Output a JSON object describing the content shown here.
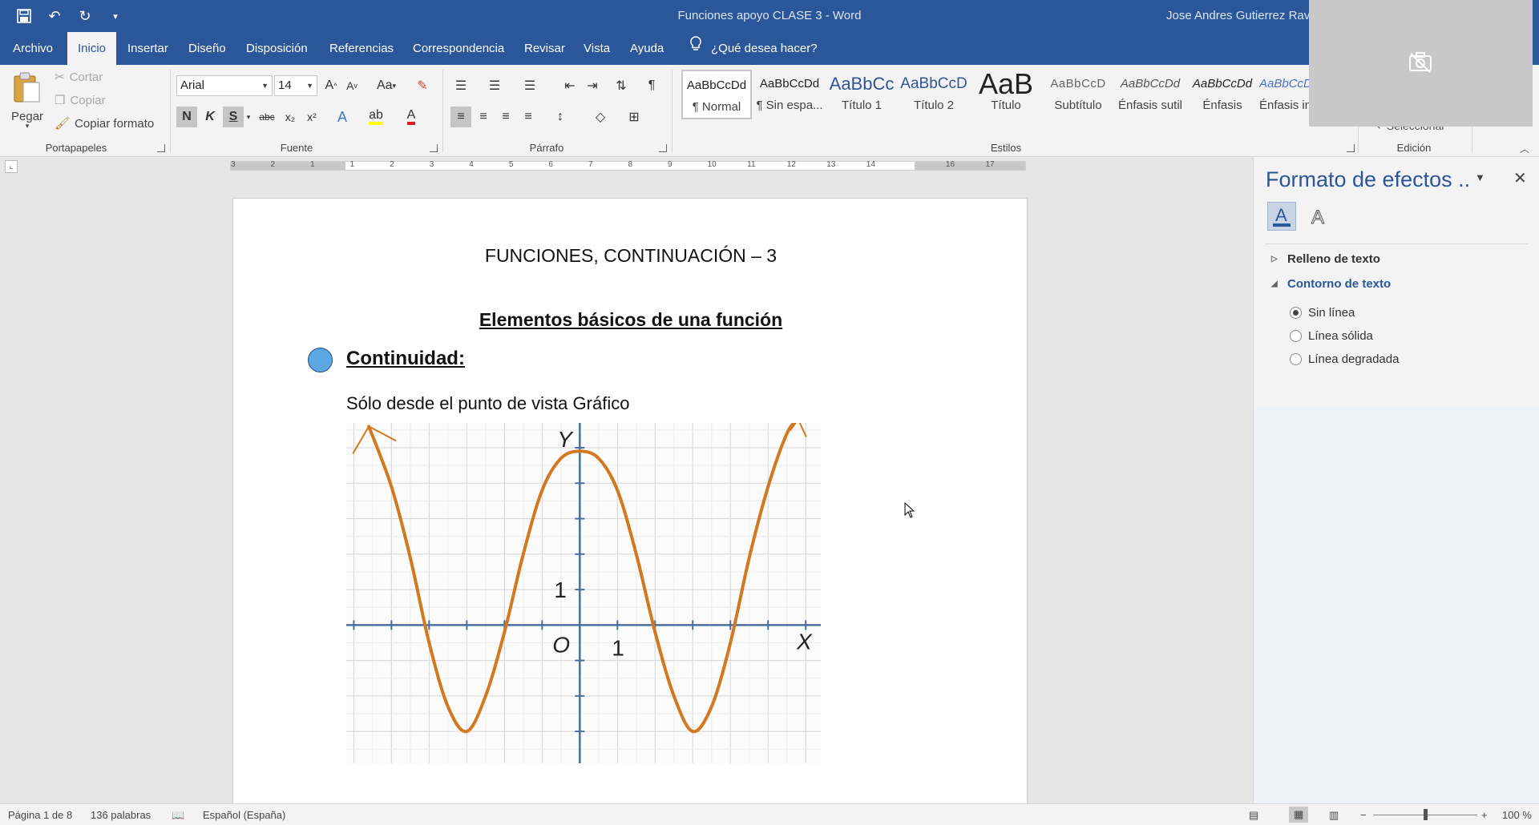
{
  "titlebar": {
    "document_title": "Funciones apoyo CLASE 3  -  Word",
    "user_name": "Jose Andres Gutierrez Rave"
  },
  "menu": {
    "tabs": [
      "Archivo",
      "Inicio",
      "Insertar",
      "Diseño",
      "Disposición",
      "Referencias",
      "Correspondencia",
      "Revisar",
      "Vista",
      "Ayuda"
    ],
    "active_tab": "Inicio",
    "tell_me": "¿Qué desea hacer?"
  },
  "ribbon": {
    "clipboard": {
      "paste": "Pegar",
      "cut": "Cortar",
      "copy": "Copiar",
      "format_painter": "Copiar formato",
      "group_label": "Portapapeles"
    },
    "font": {
      "font_name": "Arial",
      "font_size": "14",
      "group_label": "Fuente",
      "bold": "N",
      "italic": "K",
      "underline": "S",
      "strike": "abc",
      "subscript": "x₂",
      "superscript": "x²",
      "case": "Aa"
    },
    "paragraph": {
      "group_label": "Párrafo"
    },
    "styles": {
      "group_label": "Estilos",
      "items": [
        {
          "preview": "AaBbCcDd",
          "name": "¶ Normal"
        },
        {
          "preview": "AaBbCcDd",
          "name": "¶ Sin espa..."
        },
        {
          "preview": "AaBbCc",
          "name": "Título 1"
        },
        {
          "preview": "AaBbCcD",
          "name": "Título 2"
        },
        {
          "preview": "AaB",
          "name": "Título"
        },
        {
          "preview": "AaBbCcD",
          "name": "Subtítulo"
        },
        {
          "preview": "AaBbCcDd",
          "name": "Énfasis sutil"
        },
        {
          "preview": "AaBbCcDd",
          "name": "Énfasis"
        },
        {
          "preview": "AaBbCcDd",
          "name": "Énfasis in"
        }
      ]
    },
    "editing": {
      "select": "Seleccionar",
      "group_label": "Edición"
    }
  },
  "ruler": {
    "numbers": [
      "3",
      "2",
      "1",
      "1",
      "2",
      "3",
      "4",
      "5",
      "6",
      "7",
      "8",
      "9",
      "10",
      "11",
      "12",
      "13",
      "14",
      "16",
      "17"
    ]
  },
  "document": {
    "title": "FUNCIONES, CONTINUACIÓN – 3",
    "subtitle": "Elementos básicos de una función",
    "section_heading": "Continuidad:",
    "paragraph": "Sólo desde el punto de vista Gráfico",
    "graph": {
      "y_label": "Y",
      "x_label": "X",
      "origin_label": "O",
      "x_tick_label": "1",
      "y_tick_label": "1"
    }
  },
  "chart_data": {
    "type": "line",
    "title": "",
    "xlabel": "X",
    "ylabel": "Y",
    "xlim": [
      -6.2,
      6.4
    ],
    "ylim": [
      -3.9,
      5.7
    ],
    "grid": true,
    "x_tick_labels": [
      "1"
    ],
    "y_tick_labels": [
      "1"
    ],
    "series": [
      {
        "x": [
          -5.6,
          -5.0,
          -4.5,
          -4.0,
          -3.5,
          -3.0,
          -2.5,
          -2.0,
          -1.5,
          -1.0,
          -0.5,
          0.0,
          0.5,
          1.0,
          1.5,
          2.0,
          2.5,
          3.0,
          3.5,
          4.0,
          4.5,
          5.0,
          5.5,
          5.8
        ],
        "y": [
          5.6,
          3.9,
          1.9,
          -0.5,
          -2.3,
          -3.0,
          -2.0,
          -0.2,
          2.0,
          3.8,
          4.7,
          4.9,
          4.7,
          3.8,
          2.0,
          -0.2,
          -2.0,
          -3.0,
          -2.3,
          -0.5,
          1.9,
          3.9,
          5.4,
          5.8
        ]
      }
    ]
  },
  "pane": {
    "title": "Formato de efectos ..",
    "sections": [
      {
        "label": "Relleno de texto",
        "expanded": false
      },
      {
        "label": "Contorno de texto",
        "expanded": true
      }
    ],
    "options": [
      {
        "label": "Sin línea",
        "selected": true
      },
      {
        "label": "Línea sólida",
        "selected": false
      },
      {
        "label": "Línea degradada",
        "selected": false
      }
    ]
  },
  "status": {
    "page": "Página 1 de 8",
    "words": "136 palabras",
    "language": "Español (España)",
    "zoom": "100 %"
  },
  "colors": {
    "accent": "#2b579a",
    "curve": "#d2781e",
    "axis": "#4a6f9e",
    "bullet": "#5aa8e4"
  }
}
